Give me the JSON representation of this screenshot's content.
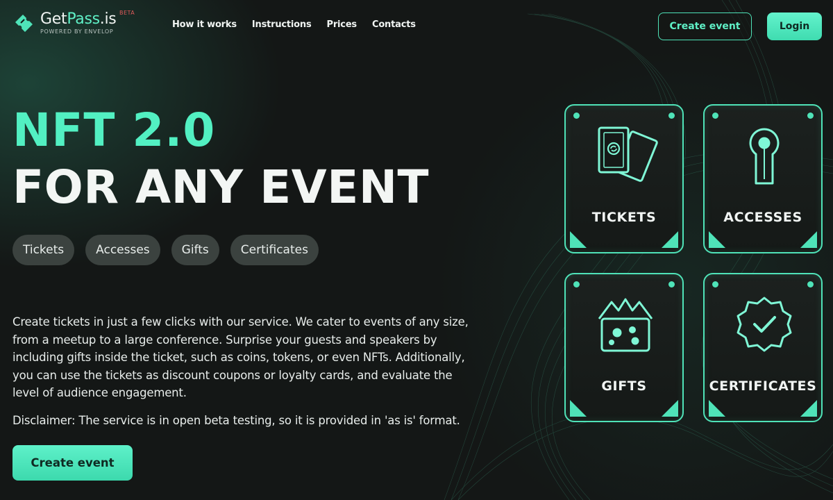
{
  "header": {
    "logo": {
      "name_part1": "Get",
      "name_part2": "Pass",
      "name_part3": ".is",
      "beta": "BETA",
      "powered_by": "POWERED BY ENVELOP"
    },
    "nav": [
      {
        "label": "How it works"
      },
      {
        "label": "Instructions"
      },
      {
        "label": "Prices"
      },
      {
        "label": "Contacts"
      }
    ],
    "create_event_label": "Create event",
    "login_label": "Login"
  },
  "hero": {
    "title_line1": "NFT 2.0",
    "title_line2": "FOR ANY EVENT",
    "chips": [
      "Tickets",
      "Accesses",
      "Gifts",
      "Certificates"
    ],
    "description": "Create tickets in just a few clicks with our service. We cater to events of any size, from a meetup to a large conference. Surprise your guests and speakers by including gifts inside the ticket, such as coins, tokens, or even NFTs. Additionally, you can use the tickets as discount coupons or loyalty cards, and evaluate the level of audience engagement.",
    "disclaimer": "Disclaimer: The service is in open beta testing, so it is provided in 'as is' format.",
    "cta_label": "Create event"
  },
  "cards": [
    {
      "label": "TICKETS",
      "icon": "tickets-icon"
    },
    {
      "label": "ACCESSES",
      "icon": "keyhole-icon"
    },
    {
      "label": "GIFTS",
      "icon": "gift-icon"
    },
    {
      "label": "CERTIFICATES",
      "icon": "certificate-badge-icon"
    }
  ],
  "colors": {
    "accent": "#52f0c2",
    "background": "#141716",
    "chip": "#3b423f"
  }
}
